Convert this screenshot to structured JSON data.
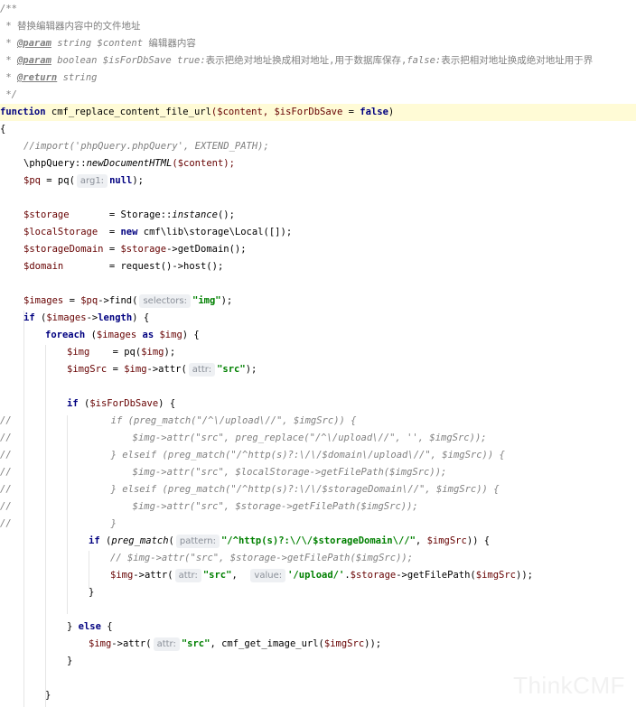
{
  "doc": {
    "l0": "/**",
    "l1": " * 替换编辑器内容中的文件地址",
    "p1_tag": "@param",
    "p1_type": "string",
    "p1_var": "$content",
    "p1_desc": "编辑器内容",
    "p2_tag": "@param",
    "p2_type": "boolean",
    "p2_var": "$isForDbSave",
    "p2_default": "true",
    "p2_desc": "表示把绝对地址换成相对地址,用于数据库保存,",
    "p2_false": "false",
    "p2_desc2": "表示把相对地址换成绝对地址用于界",
    "ret_tag": "@return",
    "ret_type": "string",
    "end": " */"
  },
  "code": {
    "fn_kw": "function",
    "fn_name": "cmf_replace_content_file_url",
    "fn_args_a": "($content, ",
    "fn_args_b": "$isForDbSave",
    "fn_args_c": " = ",
    "fn_false": "false",
    "fn_close": ")",
    "brace_open": "{",
    "c1": "//import('phpQuery.phpQuery', EXTEND_PATH);",
    "pq_ns": "\\phpQuery",
    "pq_sep": "::",
    "pq_method": "newDocumentHTML",
    "pq_arg": "($content);",
    "pq_var": "$pq",
    "pq_eq": " = pq(",
    "pq_hint": "arg1:",
    "pq_null": "null",
    "pq_end": ");",
    "st_var": "$storage",
    "st_eq": "       = Storage::",
    "st_inst": "instance",
    "st_end": "();",
    "ls_var": "$localStorage",
    "ls_eq": "  = ",
    "ls_new": "new",
    "ls_cls": " cmf\\lib\\storage\\Local([]);",
    "sd_var": "$storageDomain",
    "sd_eq": " = ",
    "sd_obj": "$storage",
    "sd_call": "->getDomain();",
    "dm_var": "$domain",
    "dm_eq": "        = request()->host();",
    "im_var": "$images",
    "im_eq": " = ",
    "im_pq": "$pq",
    "im_find": "->find(",
    "im_hint": "selectors:",
    "im_str": "\"img\"",
    "im_end": ");",
    "if_kw": "if",
    "if_open": " (",
    "if_var": "$images",
    "if_len": "->",
    "if_length": "length",
    "if_close": ") {",
    "fe_kw": "foreach",
    "fe_open": " (",
    "fe_var": "$images",
    "fe_as": " as ",
    "fe_img": "$img",
    "fe_close": ") {",
    "ig_var": "$img",
    "ig_eq": "    = pq(",
    "ig_arg": "$img",
    "ig_end": ");",
    "is_var": "$imgSrc",
    "is_eq": " = ",
    "is_img": "$img",
    "is_attr": "->attr(",
    "is_hint": "attr:",
    "is_str": "\"src\"",
    "is_end": ");",
    "if2_kw": "if",
    "if2_open": " (",
    "if2_var": "$isForDbSave",
    "if2_close": ") {",
    "cm1": "//",
    "cm1_txt": "if (preg_match(\"/^\\/upload\\//\", $imgSrc)) {",
    "cm2": "//",
    "cm2_txt": "$img->attr(\"src\", preg_replace(\"/^\\/upload\\//\", '', $imgSrc));",
    "cm3": "//",
    "cm3_txt": "} elseif (preg_match(\"/^http(s)?:\\/\\/$domain\\/upload\\//\", $imgSrc)) {",
    "cm4": "//",
    "cm4_txt": "$img->attr(\"src\", $localStorage->getFilePath($imgSrc));",
    "cm5": "//",
    "cm5_txt": "} elseif (preg_match(\"/^http(s)?:\\/\\/$storageDomain\\//\", $imgSrc)) {",
    "cm6": "//",
    "cm6_txt": "$img->attr(\"src\", $storage->getFilePath($imgSrc));",
    "cm7": "//",
    "cm7_txt": "}",
    "if3_kw": "if",
    "if3_open": " (",
    "if3_fn": "preg_match",
    "if3_p": "(",
    "if3_hint": "pattern:",
    "if3_str": "\"/^http(s)?:\\/\\/$storageDomain\\//\"",
    "if3_comma": ", ",
    "if3_var": "$imgSrc",
    "if3_close": ")) {",
    "cm8_txt": "// $img->attr(\"src\", $storage->getFilePath($imgSrc));",
    "sa_var": "$img",
    "sa_attr": "->attr(",
    "sa_hint": "attr:",
    "sa_str": "\"src\"",
    "sa_comma": ",  ",
    "sa_hint2": "value:",
    "sa_str2": "'/upload/'",
    "sa_dot": ".",
    "sa_st": "$storage",
    "sa_call": "->getFilePath(",
    "sa_arg": "$imgSrc",
    "sa_end": "));",
    "brace_close": "}",
    "else_open": "} ",
    "else_kw": "else",
    "else_b": " {",
    "el_var": "$img",
    "el_attr": "->attr(",
    "el_hint": "attr:",
    "el_str": "\"src\"",
    "el_mid": ", cmf_get_image_url(",
    "el_arg": "$imgSrc",
    "el_end": "));",
    "close1": "}",
    "close2": "}"
  },
  "watermark": "ThinkCMF"
}
